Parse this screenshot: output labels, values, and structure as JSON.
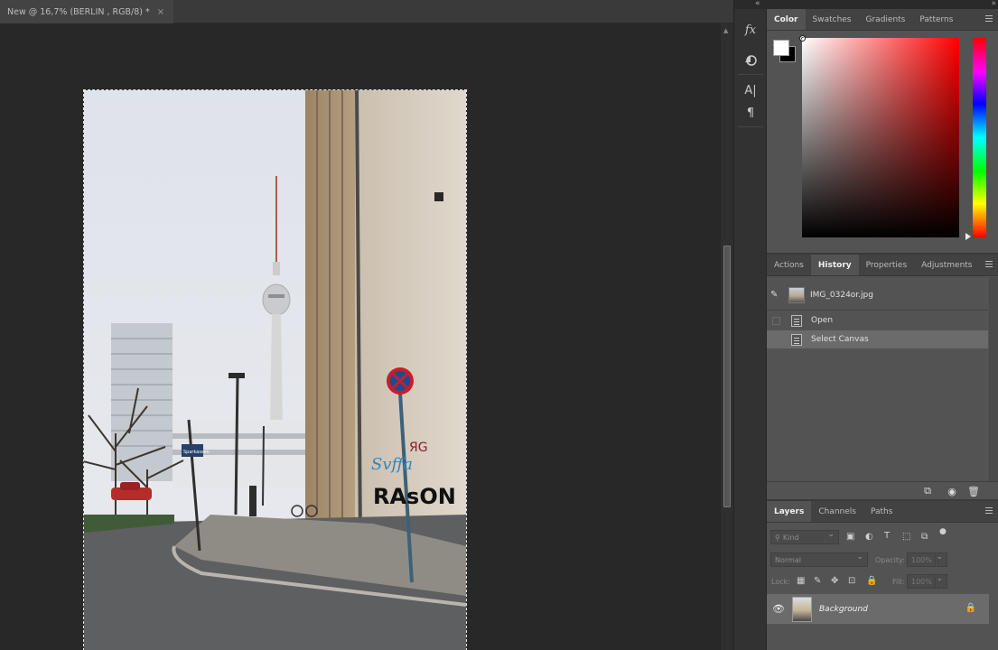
{
  "document": {
    "tab_title": "New @ 16,7% (BERLIN , RGB/8) *",
    "close_glyph": "×"
  },
  "photo": {
    "sign_text": "Sparkassen",
    "graffiti_text": "RAsON"
  },
  "tool_strip": {
    "icons": [
      "fx-icon",
      "adjust-icon",
      "character-icon",
      "paragraph-icon"
    ],
    "labels": [
      "fx",
      "A|",
      "¶"
    ]
  },
  "color_panel": {
    "tabs": [
      "Color",
      "Swatches",
      "Gradients",
      "Patterns"
    ],
    "active_tab": "Color",
    "foreground": "#ffffff",
    "background": "#000000",
    "hue": "#ff0000"
  },
  "history_panel": {
    "tabs": [
      "Actions",
      "History",
      "Properties",
      "Adjustments"
    ],
    "active_tab": "History",
    "snapshot_name": "IMG_0324or.jpg",
    "states": [
      "Open",
      "Select Canvas"
    ],
    "selected_state": "Select Canvas"
  },
  "layers_panel": {
    "tabs": [
      "Layers",
      "Channels",
      "Paths"
    ],
    "active_tab": "Layers",
    "filter_placeholder": "Kind",
    "blend_mode": "Normal",
    "opacity_label": "Opacity:",
    "opacity_value": "100%",
    "lock_label": "Lock:",
    "fill_label": "Fill:",
    "fill_value": "100%",
    "layers": [
      {
        "name": "Background",
        "visible": true,
        "locked": true
      }
    ]
  },
  "colors": {
    "panel_bg": "#535353",
    "canvas_bg": "#282828",
    "selection_highlight": "#6b6b6b"
  }
}
